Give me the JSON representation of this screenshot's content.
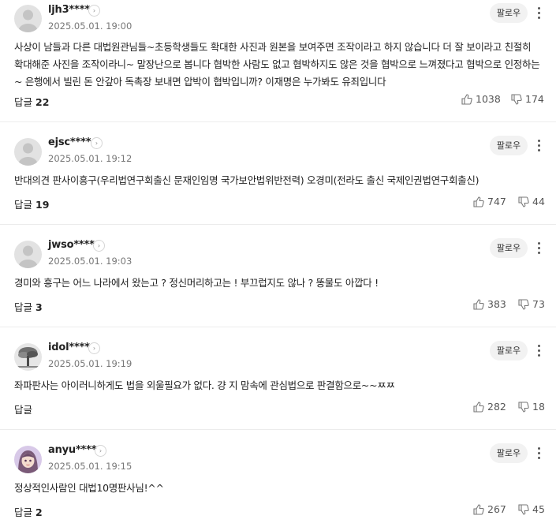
{
  "comments": [
    {
      "username": "ljh3****",
      "time": "2025.05.01. 19:00",
      "text": "사상이 남들과 다른 대법원관님들~초등학생들도 확대한 사진과 원본을 보여주면 조작이라고 하지 않습니다 더 잘 보이라고 친절히 확대해준 사진을 조작이라니~ 말장난으로 봅니다 협박한 사람도 없고 협박하지도 않은 것을 협박으로 느껴졌다고 협박으로 인정하는~ 은행에서 빌린 돈 안갚아 독촉장 보내면 압박이 협박입니까? 이재명은 누가봐도 유죄입니다",
      "reply_label": "답글",
      "reply_count": "22",
      "likes": "1038",
      "dislikes": "174"
    },
    {
      "username": "ejsc****",
      "time": "2025.05.01. 19:12",
      "text": "반대의견 판사이흥구(우리법연구회출신 문재인임명 국가보안법위반전력) 오경미(전라도 출신 국제인권법연구회출신)",
      "reply_label": "답글",
      "reply_count": "19",
      "likes": "747",
      "dislikes": "44"
    },
    {
      "username": "jwso****",
      "time": "2025.05.01. 19:03",
      "text": "경미와 흥구는 어느 나라에서 왔는고 ? 정신머리하고는 ! 부끄럽지도 않나 ? 똥물도 아깝다 !",
      "reply_label": "답글",
      "reply_count": "3",
      "likes": "383",
      "dislikes": "73"
    },
    {
      "username": "idol****",
      "time": "2025.05.01. 19:19",
      "text": "좌파판사는 아이러니하게도 법을 외울필요가 없다. 걍 지 맘속에 관심법으로 판결함으로~~ㅉㅉ",
      "reply_label": "답글",
      "reply_count": "",
      "likes": "282",
      "dislikes": "18"
    },
    {
      "username": "anyu****",
      "time": "2025.05.01. 19:15",
      "text": "정상적인사람인 대법10명판사님!^^",
      "reply_label": "답글",
      "reply_count": "2",
      "likes": "267",
      "dislikes": "45"
    }
  ],
  "follow_label": "팔로우",
  "colors": {
    "text": "#222222",
    "muted": "#777777",
    "button_bg": "#f2f2f2",
    "divider": "#ececec"
  },
  "icons": {
    "more_user": "chevron-right-icon",
    "kebab": "vertical-dots-icon",
    "like": "thumbs-up-icon",
    "dislike": "thumbs-down-icon"
  }
}
